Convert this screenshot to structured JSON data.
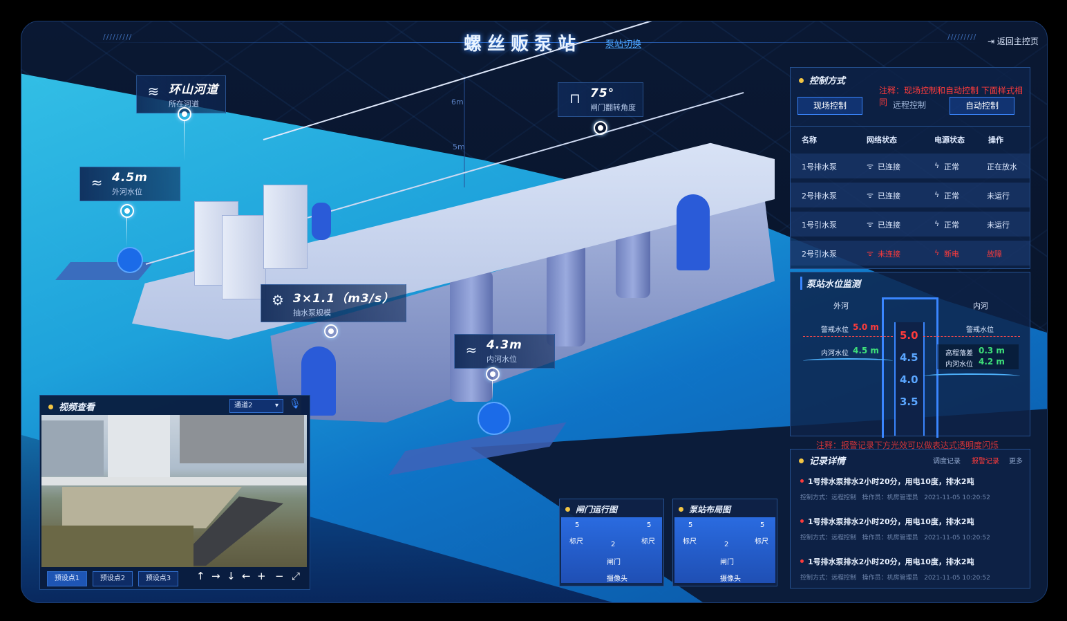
{
  "header": {
    "title": "螺丝贩泵站",
    "switch_label": "泵站切换",
    "return_label": "返回主控页",
    "stripes": "/////////"
  },
  "scene": {
    "marker_6m": "6m",
    "marker_5m": "5m",
    "tags": {
      "river": {
        "value": "环山河道",
        "label": "所在河道"
      },
      "gate_angle": {
        "value": "75°",
        "label": "闸门翻转角度"
      },
      "outer_level": {
        "value": "4.5m",
        "label": "外河水位"
      },
      "pump_scale": {
        "value": "3×1.1（m3/s）",
        "label": "抽水泵规模"
      },
      "inner_level": {
        "value": "4.3m",
        "label": "内河水位"
      }
    }
  },
  "video": {
    "title": "视频查看",
    "channel": "通道2",
    "presets": [
      "预设点1",
      "预设点2",
      "预设点3"
    ],
    "controls": {
      "up": "↑",
      "right": "→",
      "down": "↓",
      "left": "←",
      "zoom_in": "+",
      "zoom_out": "−",
      "fullscreen": "⤢"
    }
  },
  "control": {
    "title": "控制方式",
    "note": "注释：现场控制和自动控制 下面样式相同",
    "modes": [
      "现场控制",
      "远程控制",
      "自动控制"
    ],
    "columns": [
      "名称",
      "网络状态",
      "电源状态",
      "操作"
    ],
    "rows": [
      {
        "name": "1号排水泵",
        "network": "已连接",
        "power": "正常",
        "op": "正在放水",
        "alarm": false
      },
      {
        "name": "2号排水泵",
        "network": "已连接",
        "power": "正常",
        "op": "未运行",
        "alarm": false
      },
      {
        "name": "1号引水泵",
        "network": "已连接",
        "power": "正常",
        "op": "未运行",
        "alarm": false
      },
      {
        "name": "2号引水泵",
        "network": "未连接",
        "power": "断电",
        "op": "故障",
        "alarm": true
      }
    ]
  },
  "water_monitor": {
    "title": "泵站水位监测",
    "outer": "外河",
    "inner": "内河",
    "warn_left_label": "警戒水位",
    "warn_left_value": "5.0 m",
    "inner_left_label": "内河水位",
    "inner_left_value": "4.5 m",
    "warn_right_label": "警戒水位",
    "diff_label": "高程落差",
    "diff_value": "0.3 m",
    "inner_right_label": "内河水位",
    "inner_right_value": "4.2 m",
    "scale": [
      "5.0",
      "4.5",
      "4.0",
      "3.5"
    ]
  },
  "records": {
    "note": "注释：报警记录下方光效可以做表达式透明度闪烁",
    "title": "记录详情",
    "tabs": [
      "调度记录",
      "报警记录",
      "更多"
    ],
    "items": [
      {
        "main": "1号排水泵排水2小时20分，用电10度，排水2吨",
        "mode": "控制方式：远程控制",
        "operator": "操作员：机房管理员",
        "time": "2021-11-05 10:20:52"
      },
      {
        "main": "1号排水泵排水2小时20分，用电10度，排水2吨",
        "mode": "控制方式：远程控制",
        "operator": "操作员：机房管理员",
        "time": "2021-11-05 10:20:52"
      },
      {
        "main": "1号排水泵排水2小时20分，用电10度，排水2吨",
        "mode": "控制方式：远程控制",
        "operator": "操作员：机房管理员",
        "time": "2021-11-05 10:20:52"
      }
    ]
  },
  "gate_panel": {
    "title": "闸门运行图",
    "n1": "5",
    "n2": "5",
    "n3": "2",
    "ruler1": "标尺",
    "ruler2": "标尺",
    "gate": "闸门",
    "camera": "摄像头"
  },
  "layout_panel": {
    "title": "泵站布局图",
    "n1": "5",
    "n2": "5",
    "n3": "2",
    "ruler1": "标尺",
    "ruler2": "标尺",
    "gate": "闸门",
    "camera": "摄像头"
  }
}
